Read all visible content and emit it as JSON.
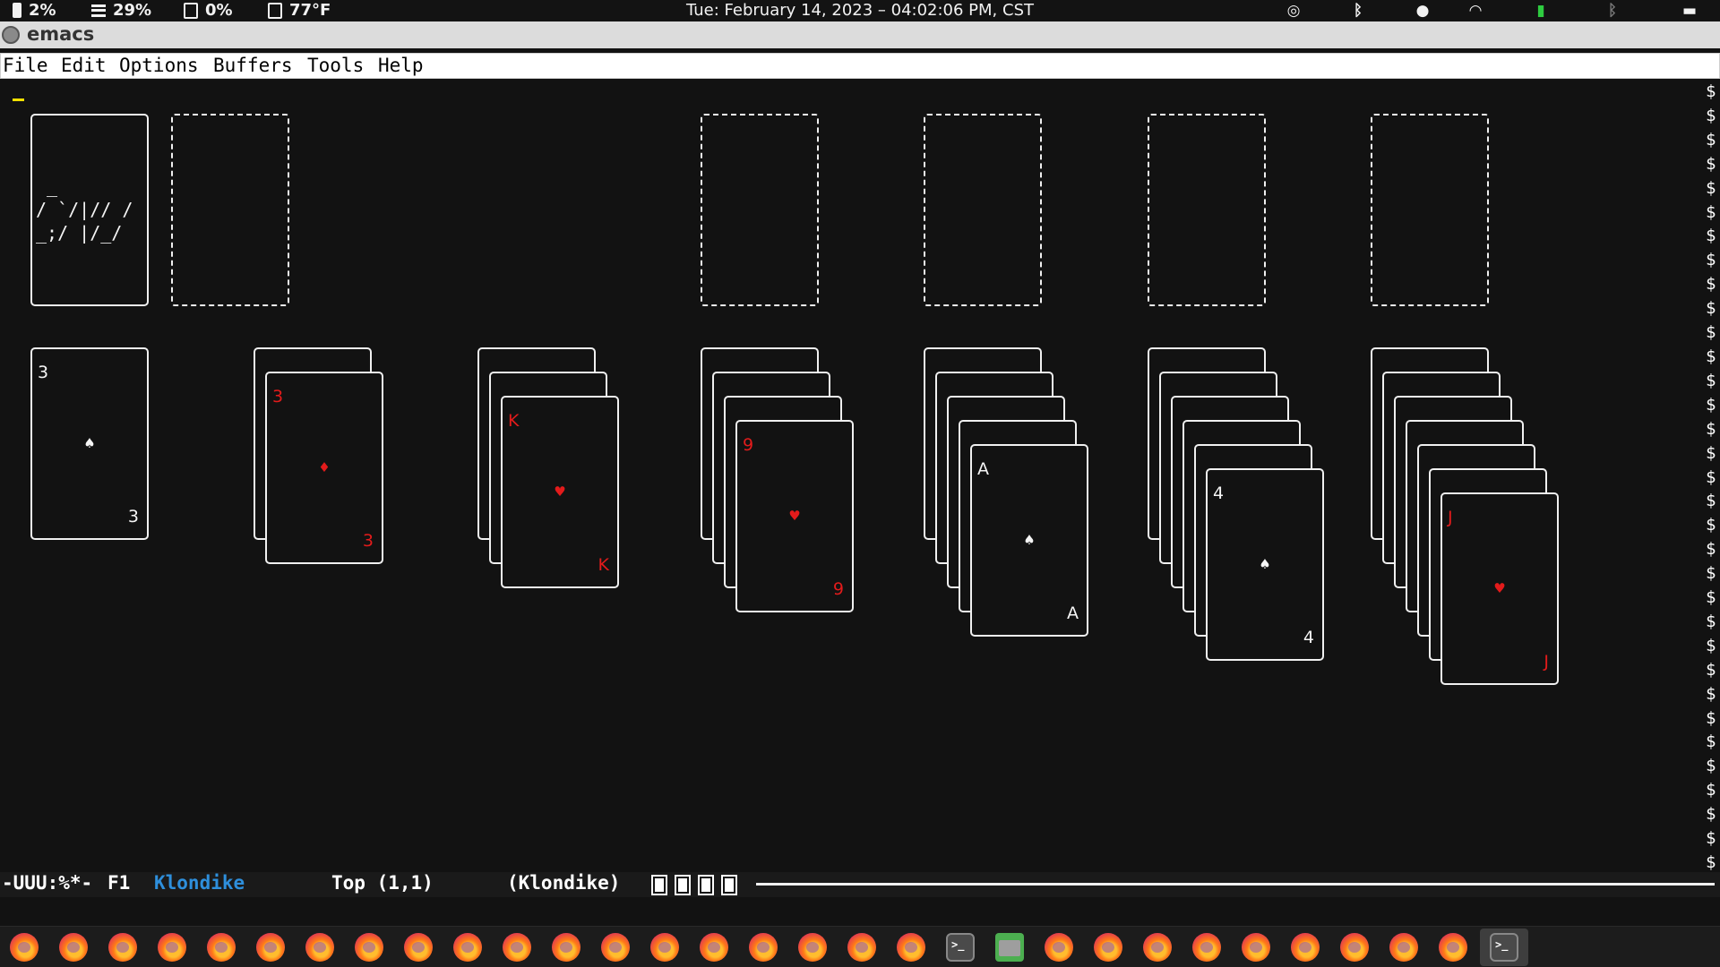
{
  "system_bar": {
    "battery": "2%",
    "memory": "29%",
    "cpu": "0%",
    "temperature": "77°F",
    "clock": "Tue: February 14, 2023 – 04:02:06 PM, CST",
    "battery_icon_color": "#2ecc40"
  },
  "window": {
    "title": "emacs"
  },
  "menubar": {
    "items": [
      "File",
      "Edit",
      "Options",
      "Buffers",
      "Tools",
      "Help"
    ]
  },
  "game": {
    "name": "Klondike",
    "stock_art": [
      " _",
      "/ `/|// /",
      "_;/ |/_/"
    ],
    "tableau": [
      {
        "hidden": 0,
        "rank": "3",
        "suit": "♠",
        "color": "white"
      },
      {
        "hidden": 1,
        "rank": "3",
        "suit": "♦",
        "color": "red"
      },
      {
        "hidden": 2,
        "rank": "K",
        "suit": "♥",
        "color": "red"
      },
      {
        "hidden": 3,
        "rank": "9",
        "suit": "♥",
        "color": "red"
      },
      {
        "hidden": 4,
        "rank": "A",
        "suit": "♠",
        "color": "white"
      },
      {
        "hidden": 5,
        "rank": "4",
        "suit": "♠",
        "color": "white"
      },
      {
        "hidden": 6,
        "rank": "J",
        "suit": "♥",
        "color": "red"
      }
    ]
  },
  "fringe": {
    "marker": "$"
  },
  "modeline": {
    "status": "-UUU:%*-",
    "frame": "F1",
    "buffer": "Klondike",
    "position": "Top (1,1)",
    "mode": "(Klondike)"
  },
  "dock": {
    "items": [
      "firefox",
      "firefox",
      "firefox",
      "firefox",
      "firefox",
      "firefox",
      "firefox",
      "firefox",
      "firefox",
      "firefox",
      "firefox",
      "firefox",
      "firefox",
      "firefox",
      "firefox",
      "firefox",
      "firefox",
      "firefox",
      "firefox",
      "terminal",
      "files",
      "firefox",
      "firefox",
      "firefox",
      "firefox",
      "firefox",
      "firefox",
      "firefox",
      "firefox",
      "firefox",
      "terminal"
    ]
  }
}
